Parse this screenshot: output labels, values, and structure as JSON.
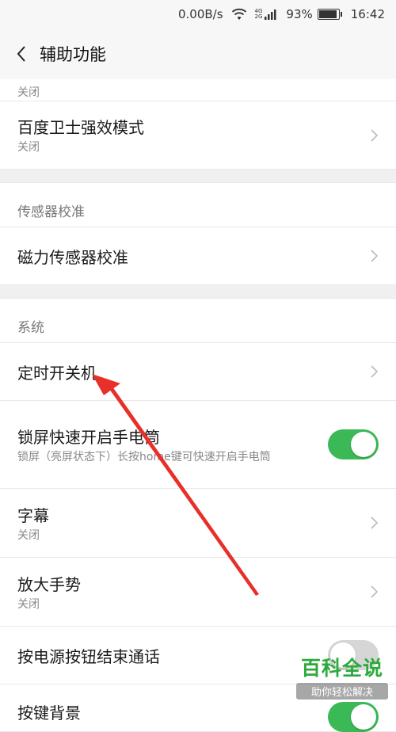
{
  "status_bar": {
    "speed": "0.00B/s",
    "net_top": "4G",
    "net_bottom": "2G",
    "battery_text": "93%",
    "battery_level": 0.93,
    "time": "16:42"
  },
  "header": {
    "title": "辅助功能"
  },
  "rows": {
    "partial_sub": "关闭",
    "baidu": {
      "main": "百度卫士强效模式",
      "sub": "关闭"
    },
    "sensor_section": "传感器校准",
    "magnetic": {
      "main": "磁力传感器校准"
    },
    "system_section": "系统",
    "timer": {
      "main": "定时开关机"
    },
    "flashlight": {
      "main": "锁屏快速开启手电筒",
      "sub": "锁屏（亮屏状态下）长按home键可快速开启手电筒",
      "toggle_on": true
    },
    "subtitles": {
      "main": "字幕",
      "sub": "关闭"
    },
    "magnify": {
      "main": "放大手势",
      "sub": "关闭"
    },
    "power_end_call": {
      "main": "按电源按钮结束通话",
      "toggle_on": false
    },
    "last_partial": {
      "main": "按键背景"
    }
  },
  "watermark": {
    "main": "百科全说",
    "sub": "助你轻松解决"
  },
  "colors": {
    "toggle_on": "#3ab956",
    "toggle_off": "#d6d6d6",
    "arrow": "#e8302a",
    "watermark": "#2ca93b"
  }
}
